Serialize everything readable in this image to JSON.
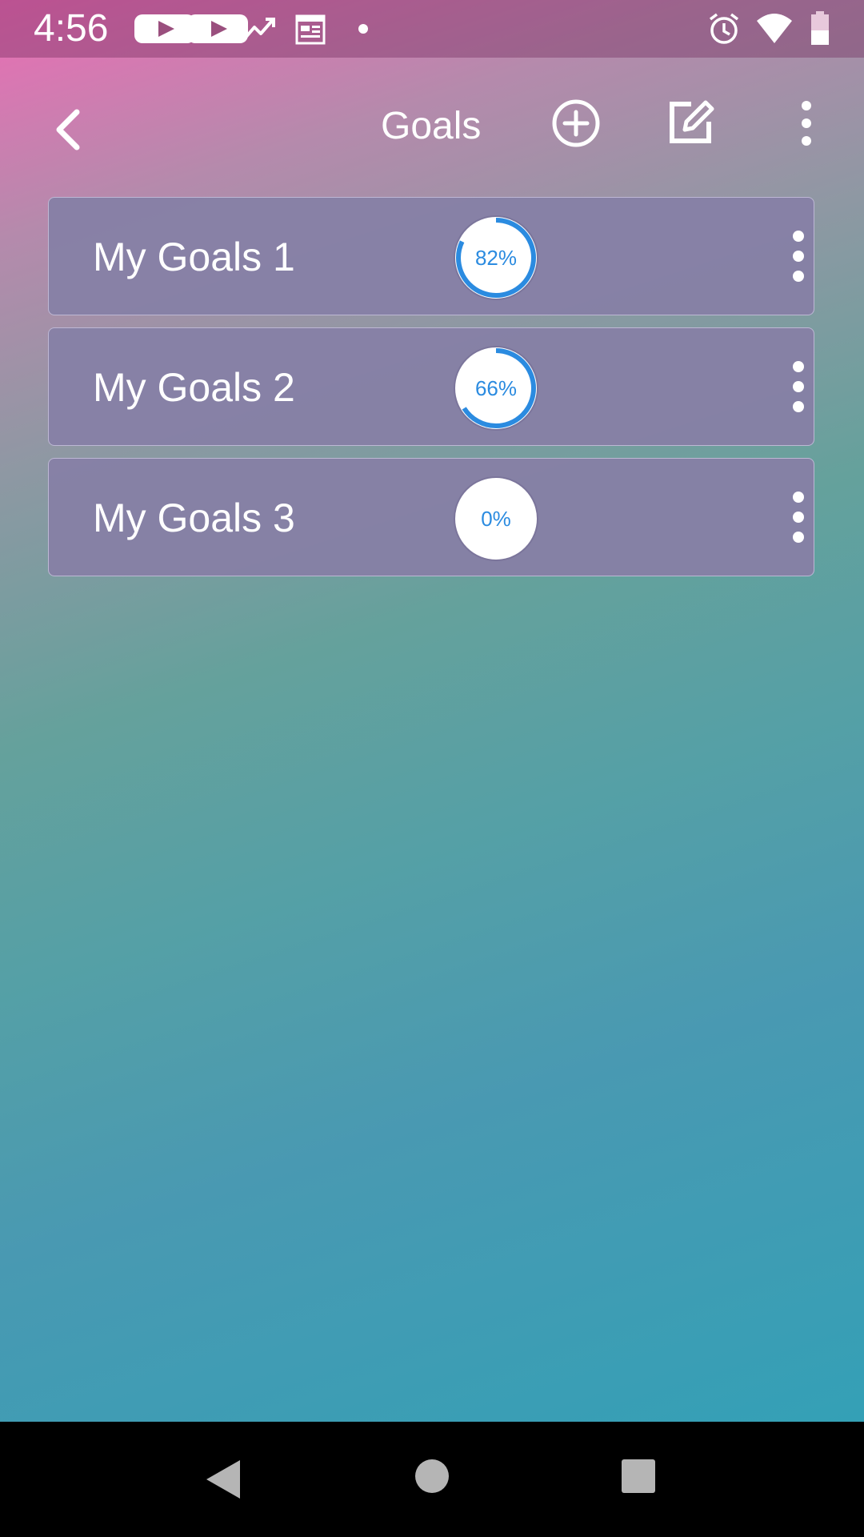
{
  "status_bar": {
    "time": "4:56",
    "left_icons": [
      "youtube-icon",
      "youtube-icon",
      "trending-icon",
      "calendar-icon",
      "dot-icon"
    ],
    "right_icons": [
      "alarm-icon",
      "wifi-icon",
      "battery-icon"
    ]
  },
  "toolbar": {
    "title": "Goals",
    "buttons": [
      "back-icon",
      "add-circle-icon",
      "edit-icon",
      "more-vert-icon"
    ]
  },
  "goals": [
    {
      "label": "My Goals 1",
      "progress_text": "82%",
      "progress": 0.82
    },
    {
      "label": "My Goals 2",
      "progress_text": "66%",
      "progress": 0.66
    },
    {
      "label": "My Goals 3",
      "progress_text": "0%",
      "progress": 0.0
    }
  ],
  "colors": {
    "accent": "#2b8be0",
    "card": "#8680a6",
    "gradient_top": "#ec6db5",
    "gradient_bottom": "#34a0b6"
  },
  "nav_bar": [
    "nav-back-icon",
    "nav-home-icon",
    "nav-recents-icon"
  ]
}
